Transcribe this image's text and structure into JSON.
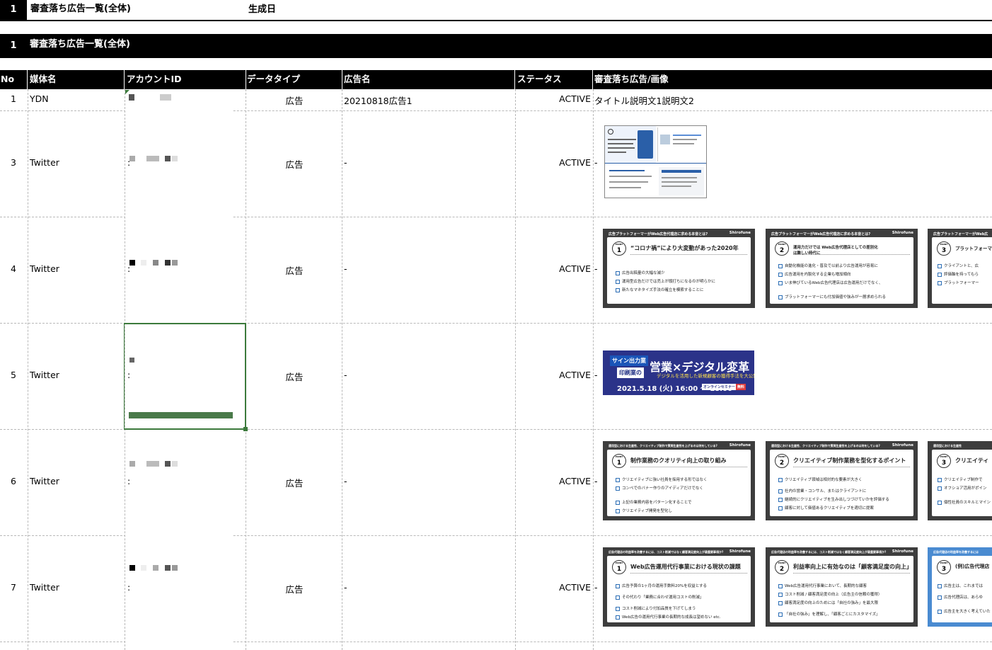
{
  "title_row": {
    "number": "1",
    "title": "審査落ち広告一覧(全体)",
    "generated_label": "生成日"
  },
  "section": {
    "number": "1",
    "title": "審査落ち広告一覧(全体)"
  },
  "columns": [
    "No",
    "媒体名",
    "アカウントID",
    "データタイプ",
    "広告名",
    "ステータス",
    "審査落ち広告/画像"
  ],
  "rows": [
    {
      "no": "1",
      "media": "YDN",
      "account_mark": "",
      "data_type": "広告",
      "ad_name": "20210818広告1",
      "status": "ACTIVE",
      "ad_content": "タイトル説明文1説明文2"
    },
    {
      "no": "3",
      "media": "Twitter",
      "account_mark": ":",
      "data_type": "広告",
      "ad_name": "-",
      "status": "ACTIVE",
      "ad_content": "-"
    },
    {
      "no": "4",
      "media": "Twitter",
      "account_mark": ":",
      "data_type": "広告",
      "ad_name": "-",
      "status": "ACTIVE",
      "ad_content": "-"
    },
    {
      "no": "5",
      "media": "Twitter",
      "account_mark": ":",
      "data_type": "広告",
      "ad_name": "-",
      "status": "ACTIVE",
      "ad_content": "-"
    },
    {
      "no": "6",
      "media": "Twitter",
      "account_mark": ":",
      "data_type": "広告",
      "ad_name": "-",
      "status": "ACTIVE",
      "ad_content": "-"
    },
    {
      "no": "7",
      "media": "Twitter",
      "account_mark": ":",
      "data_type": "広告",
      "ad_name": "-",
      "status": "ACTIVE",
      "ad_content": "-"
    }
  ],
  "slides": {
    "brand": "Shirofune",
    "row4": [
      {
        "header": "広告プラットフォーマーがWeb広告代理店に求める本音とは?",
        "point": "1",
        "title": "“コロナ禍”により大変動があった2020年",
        "bullets": [
          "広告出稿量の大幅な減少",
          "運用型広告だけでは売上が頭打ちになるのが明らかに",
          "新たなマネタイズ手法の確立を模索することに"
        ]
      },
      {
        "header": "広告プラットフォーマーがWeb広告代理店に求める本音とは?",
        "point": "2",
        "title": "運用力だけでは Web広告代理店としての差別化は難しい時代に",
        "bullets": [
          "自動化機能の進化・普及で以前より広告運用が容易に",
          "広告運用を内製化する企業も増加傾向",
          "いま伸びているWeb広告代理店は広告運用だけでなく、",
          "ブラットフォーマーにも付加価値や強みが一層求められる"
        ]
      },
      {
        "header": "広告プラットフォーマーがWeb広",
        "point": "3",
        "title": "プラットフォーマ",
        "bullets": [
          "クライアントと、広",
          "評価軸を持ってもら",
          "プラットフォーマー"
        ]
      }
    ],
    "row6": [
      {
        "header": "運用型における生産性、クリエイティブ制作で質問生産性を上げるのは何をしている?",
        "point": "1",
        "title": "制作業務のクオリティ向上の取り組み",
        "bullets": [
          "クリエイティブに強い社員を採用する形ではなく",
          "コンペでのバナー作りのアイディアだけでなく",
          "上記の業務内容をパターン化することで",
          "クリエイティブ開発を型化し"
        ]
      },
      {
        "header": "運用型における生産性、クリエイティブ制作で質問生産性を上げるのは何をしている?",
        "point": "2",
        "title": "クリエイティブ制作業務を型化するポイント",
        "bullets": [
          "クリエイティブ領域は相対的な要素が大きく",
          "社内の営業・コンサル、またはクライアントに",
          "継続的にクリエイティブを生み出しつづけていかを評価する",
          "顧客に対して価値あるクリエイティブを適切に提案"
        ]
      },
      {
        "header": "運用型における生産性",
        "point": "3",
        "title": "クリエイティ",
        "bullets": [
          "クリエイティブ制作で",
          "オフショア活用がポイン",
          "個性社員のスキルとマイン"
        ]
      }
    ],
    "row7": [
      {
        "header": "広告代理店の利益率を改善するには、コスト削減ではなく顧客満足度向上が最重要事項か?",
        "point": "1",
        "title": "Web広告運用代行事業における現状の課題",
        "bullets": [
          "広告予算の1ヶ月の運用手数料20%を収益とする",
          "その代わり「業務に合わせ運用コストの削減」",
          "コスト削減により付加品質を下げてしまう",
          "Web広告の運用代行事業の長期的な成長は望めない etc."
        ]
      },
      {
        "header": "広告代理店の利益率を改善するには、コスト削減ではなく顧客満足度向上が最重要事項か?",
        "point": "2",
        "title": "利益率向上に有効なのは「顧客満足度の向上」",
        "bullets": [
          "Web広告運用代行事業において、長期的な顧客",
          "コスト削減 / 顧客満足度の向上（広告主の信頼の獲得）",
          "顧客満足度の向上のためには「自社の強み」を最大限",
          "「自社の強み」を理解し、「顧客ごとにカスタマイズ」"
        ]
      },
      {
        "header": "広告代理店の利益率を改善するには",
        "point": "3",
        "title": "(例)広告代理店",
        "bullets": [
          "広告主は、これまでは",
          "広告代理店は、あらゆ",
          "広告主を大きく考えていた"
        ]
      }
    ]
  },
  "banner": {
    "tag1": "サイン出力業",
    "tag2": "印刷業の",
    "headline": "営業×デジタル変革",
    "sub": "デジタルを活用した新規顧客の獲得手法を大公開",
    "date": "2021.5.18 (火) 16:00 〜 18:00",
    "badge": "オンラインセミナー",
    "free": "無料"
  }
}
